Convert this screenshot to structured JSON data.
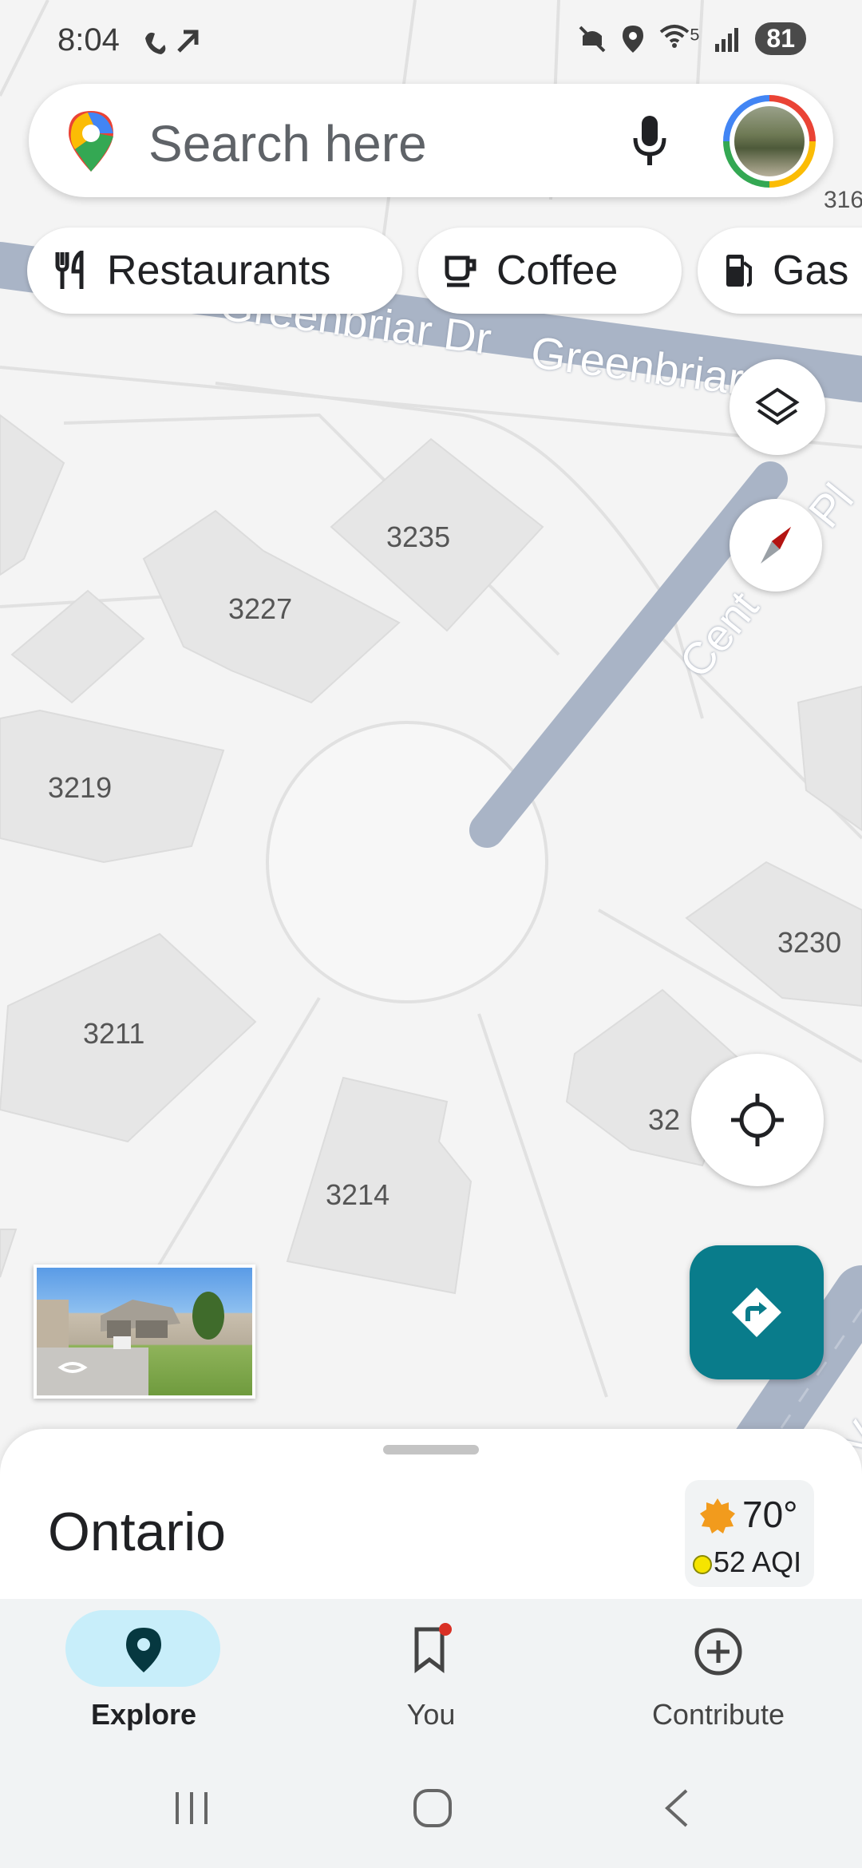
{
  "status_bar": {
    "time": "8:04",
    "wifi_label": "5",
    "battery": "81"
  },
  "search": {
    "placeholder": "Search here"
  },
  "chips": [
    {
      "label": "Restaurants",
      "icon": "fork-knife-icon"
    },
    {
      "label": "Coffee",
      "icon": "coffee-cup-icon"
    },
    {
      "label": "Gas",
      "icon": "gas-pump-icon"
    }
  ],
  "map": {
    "streets": [
      "Greenbriar Dr",
      "Greenbriar",
      "Cent",
      "Pl",
      "Ve"
    ],
    "house_numbers": [
      "3235",
      "3227",
      "3219",
      "3230",
      "3211",
      "32",
      "3214",
      "316"
    ]
  },
  "sheet": {
    "place_name": "Ontario",
    "temperature": "70°",
    "aqi": "52 AQI"
  },
  "nav": {
    "items": [
      {
        "label": "Explore",
        "icon": "map-pin-icon",
        "active": true
      },
      {
        "label": "You",
        "icon": "bookmark-icon",
        "active": false
      },
      {
        "label": "Contribute",
        "icon": "plus-circle-icon",
        "active": false
      }
    ]
  },
  "colors": {
    "accent": "#097c8b",
    "explore_active": "#c8eefa",
    "street": "#a9b4c6",
    "building": "#e6e6e6",
    "map_bg": "#f4f4f4"
  }
}
